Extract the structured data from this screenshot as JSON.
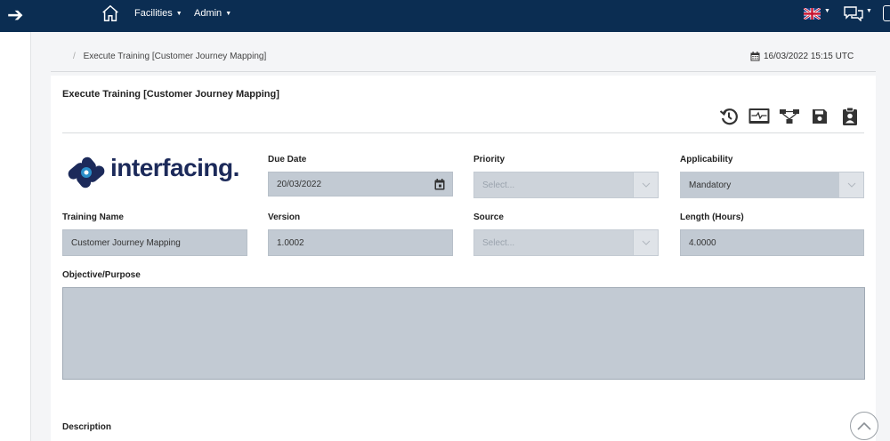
{
  "nav": {
    "menus": [
      {
        "label": "Facilities"
      },
      {
        "label": "Admin"
      }
    ]
  },
  "breadcrumb": {
    "separator": "/",
    "current": "Execute Training [Customer Journey Mapping]"
  },
  "datetime": "16/03/2022 15:15 UTC",
  "card": {
    "title": "Execute Training [Customer Journey Mapping]"
  },
  "logo": {
    "text": "interfacing."
  },
  "form": {
    "due_date": {
      "label": "Due Date",
      "value": "20/03/2022"
    },
    "priority": {
      "label": "Priority",
      "placeholder": "Select..."
    },
    "applicability": {
      "label": "Applicability",
      "value": "Mandatory"
    },
    "training_name": {
      "label": "Training Name",
      "value": "Customer Journey Mapping"
    },
    "version": {
      "label": "Version",
      "value": "1.0002"
    },
    "source": {
      "label": "Source",
      "placeholder": "Select..."
    },
    "length": {
      "label": "Length (Hours)",
      "value": "4.0000"
    },
    "objective": {
      "label": "Objective/Purpose",
      "value": ""
    },
    "description": {
      "label": "Description"
    }
  },
  "icons": {
    "toolbar": [
      "history-icon",
      "activity-monitor-icon",
      "workflow-icon",
      "save-icon",
      "clipboard-user-icon"
    ]
  },
  "colors": {
    "topbar": "#0b2d52",
    "field": "#c2cad3",
    "logo": "#1c2a5a"
  }
}
